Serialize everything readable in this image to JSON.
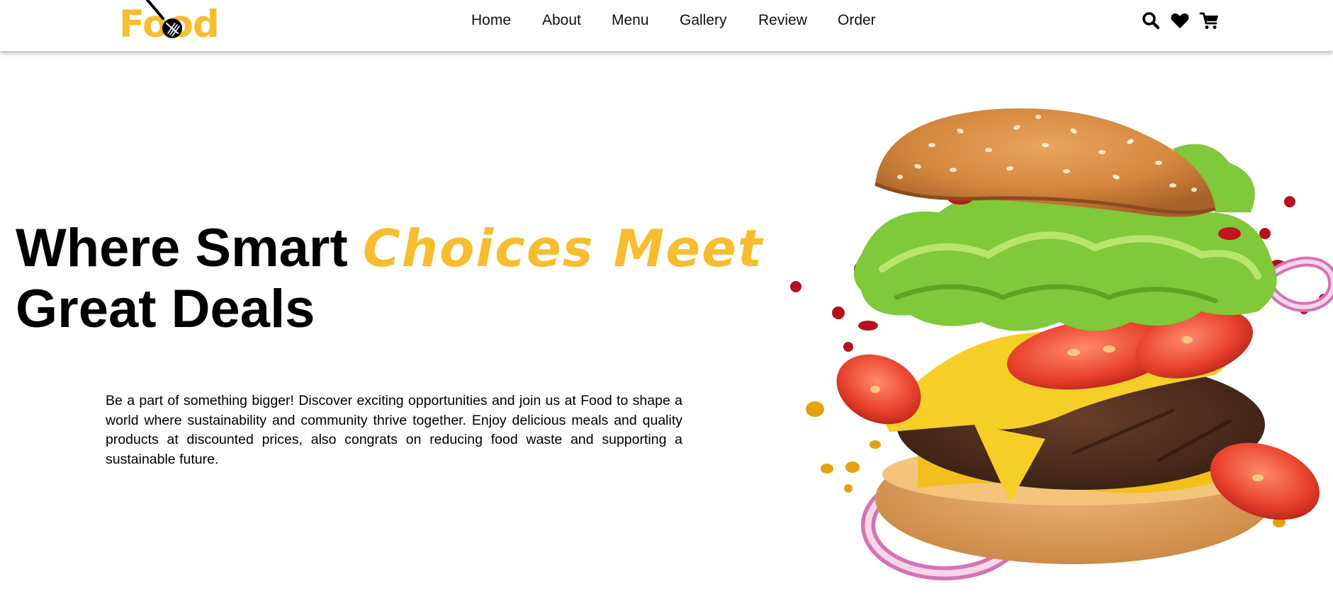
{
  "brand": {
    "logo_text": "Food",
    "accent_color": "#f7bd2e"
  },
  "nav": {
    "items": [
      {
        "label": "Home"
      },
      {
        "label": "About"
      },
      {
        "label": "Menu"
      },
      {
        "label": "Gallery"
      },
      {
        "label": "Review"
      },
      {
        "label": "Order"
      }
    ]
  },
  "header_icons": [
    {
      "icon": "search-icon"
    },
    {
      "icon": "heart-icon"
    },
    {
      "icon": "cart-icon"
    }
  ],
  "hero": {
    "title_part1": "Where Smart ",
    "title_accent": "Choices Meet",
    "title_part2": "Great Deals",
    "description": "Be a part of something bigger! Discover exciting opportunities and join us at Food to shape a world where sustainability and community thrive together. Enjoy delicious meals and quality products at discounted prices, also congrats on reducing food waste and supporting a sustainable future.",
    "image": "burger-illustration"
  }
}
